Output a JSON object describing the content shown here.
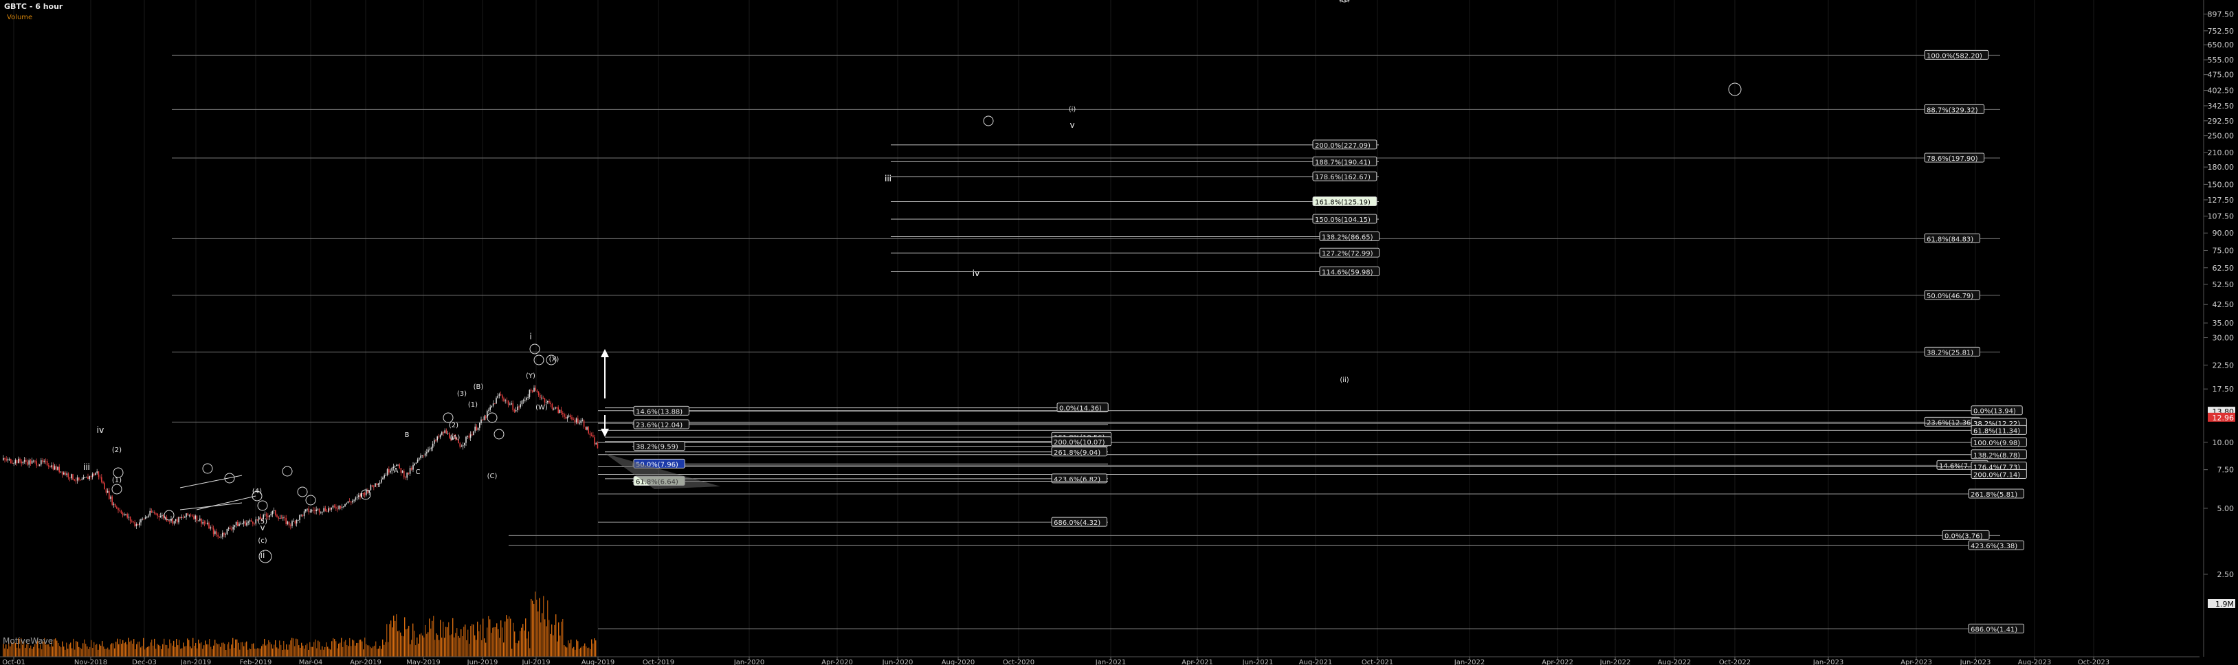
{
  "title": "GBTC - 6 hour",
  "subtitle": "Volume",
  "logo": "MotiveWave",
  "chart_data": {
    "type": "line",
    "scale": "log",
    "ylim": [
      1.53,
      1040
    ],
    "price_ticks": [
      897.5,
      752.5,
      650.0,
      555.0,
      475.0,
      402.5,
      342.5,
      292.5,
      250.0,
      210.0,
      180.0,
      150.0,
      127.5,
      107.5,
      90.0,
      75.0,
      62.5,
      52.5,
      42.5,
      35.0,
      30.0,
      22.5,
      17.5,
      10.0,
      7.5,
      5.0,
      2.5
    ],
    "current_price_tags": [
      "13.80",
      "12.96"
    ],
    "volume_tag": "1.9M",
    "x_tick_labels": [
      "Oct-01",
      "Nov-2018",
      "Dec-03",
      "Jan-2019",
      "Feb-2019",
      "Mar-04",
      "Apr-2019",
      "May-2019",
      "Jun-2019",
      "Jul-2019",
      "Aug-2019",
      "Oct-2019",
      "Jan-2020",
      "Apr-2020",
      "Jun-2020",
      "Aug-2020",
      "Oct-2020",
      "Jan-2021",
      "Apr-2021",
      "Jun-2021",
      "Aug-2021",
      "Oct-2021",
      "Jan-2022",
      "Apr-2022",
      "Jun-2022",
      "Aug-2022",
      "Oct-2022",
      "Jan-2023",
      "Apr-2023",
      "Jun-2023",
      "Aug-2023",
      "Oct-2023"
    ],
    "price_series": [
      {
        "t": 0,
        "v": 8.3
      },
      {
        "t": 8,
        "v": 8.0
      },
      {
        "t": 14,
        "v": 6.6
      },
      {
        "t": 17,
        "v": 7.3
      },
      {
        "t": 20,
        "v": 5.2
      },
      {
        "t": 24,
        "v": 4.2
      },
      {
        "t": 27,
        "v": 4.8
      },
      {
        "t": 31,
        "v": 4.35
      },
      {
        "t": 34,
        "v": 4.7
      },
      {
        "t": 37,
        "v": 4.2
      },
      {
        "t": 39,
        "v": 3.7
      },
      {
        "t": 42,
        "v": 4.2
      },
      {
        "t": 46,
        "v": 4.4
      },
      {
        "t": 49,
        "v": 4.8
      },
      {
        "t": 52,
        "v": 4.2
      },
      {
        "t": 55,
        "v": 4.85
      },
      {
        "t": 60,
        "v": 5.0
      },
      {
        "t": 64,
        "v": 5.5
      },
      {
        "t": 68,
        "v": 6.6
      },
      {
        "t": 71,
        "v": 8.0
      },
      {
        "t": 73,
        "v": 7.0
      },
      {
        "t": 76,
        "v": 8.7
      },
      {
        "t": 80,
        "v": 11.2
      },
      {
        "t": 83,
        "v": 9.7
      },
      {
        "t": 87,
        "v": 12.6
      },
      {
        "t": 90,
        "v": 16.5
      },
      {
        "t": 93,
        "v": 14.0
      },
      {
        "t": 96,
        "v": 17.5
      },
      {
        "t": 100,
        "v": 14.3
      },
      {
        "t": 103,
        "v": 12.7
      },
      {
        "t": 105,
        "v": 12.5
      },
      {
        "t": 108,
        "v": 9.3
      }
    ],
    "wave_labels": [
      "iv",
      "iii",
      "(2)",
      "(1)",
      "(3)",
      "(4)",
      "(5)",
      "(c)",
      "ii",
      "v",
      "i",
      "A",
      "B",
      "C",
      "(A)",
      "(B)",
      "(C)",
      "(X)",
      "(W)",
      "(Y)",
      "(i)",
      "(ii)",
      "(iv)",
      "iv",
      "iii"
    ],
    "fib_levels": [
      {
        "label": "100.0%(582.20)",
        "price": 582.2
      },
      {
        "label": "88.7%(329.32)",
        "price": 329.32
      },
      {
        "label": "78.6%(197.90)",
        "price": 197.9
      },
      {
        "label": "61.8%(84.83)",
        "price": 84.83
      },
      {
        "label": "50.0%(46.79)",
        "price": 46.79
      },
      {
        "label": "38.2%(25.81)",
        "price": 25.81
      },
      {
        "label": "23.6%(12.36)",
        "price": 12.36
      },
      {
        "label": "14.6%(7.85)",
        "price": 7.85
      },
      {
        "label": "0.0%(3.76)",
        "price": 3.76
      },
      {
        "label": "200.0%(227.09)",
        "price": 227.09
      },
      {
        "label": "188.7%(190.41)",
        "price": 190.41
      },
      {
        "label": "178.6%(162.67)",
        "price": 162.67
      },
      {
        "label": "161.8%(125.19)",
        "price": 125.19
      },
      {
        "label": "150.0%(104.15)",
        "price": 104.15
      },
      {
        "label": "138.2%(86.65)",
        "price": 86.65
      },
      {
        "label": "127.2%(72.99)",
        "price": 72.99
      },
      {
        "label": "114.6%(59.98)",
        "price": 59.98
      },
      {
        "label": "0.0%(13.94)",
        "price": 13.94
      },
      {
        "label": "38.2%(12.22)",
        "price": 12.22
      },
      {
        "label": "61.8%(11.34)",
        "price": 11.34
      },
      {
        "label": "100.0%(9.98)",
        "price": 9.98
      },
      {
        "label": "138.2%(8.78)",
        "price": 8.78
      },
      {
        "label": "176.4%(7.73)",
        "price": 7.73
      },
      {
        "label": "200.0%(7.14)",
        "price": 7.14
      },
      {
        "label": "261.8%(5.81)",
        "price": 5.81
      },
      {
        "label": "423.6%(3.38)",
        "price": 3.38
      },
      {
        "label": "686.0%(1.41)",
        "price": 1.41
      },
      {
        "label": "0.0%(14.36)",
        "price": 14.36
      },
      {
        "label": "161.8%(10.56)",
        "price": 10.56
      },
      {
        "label": "200.0%(10.07)",
        "price": 10.07
      },
      {
        "label": "261.8%(9.04)",
        "price": 9.04
      },
      {
        "label": "423.6%(6.82)",
        "price": 6.82
      },
      {
        "label": "686.0%(4.32)",
        "price": 4.32
      },
      {
        "label": "14.6%(13.88)",
        "price": 13.88
      },
      {
        "label": "23.6%(12.04)",
        "price": 12.04
      },
      {
        "label": "38.2%(9.59)",
        "price": 9.59
      },
      {
        "label": "50.0%(7.96)",
        "price": 7.96
      },
      {
        "label": "61.8%(6.64)",
        "price": 6.64
      }
    ],
    "grid": true
  }
}
